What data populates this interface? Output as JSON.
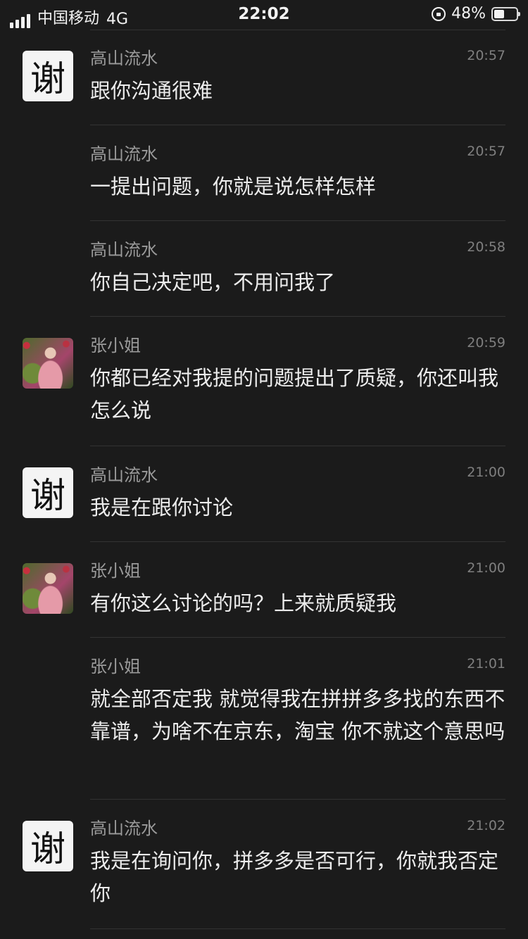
{
  "status_bar": {
    "carrier": "中国移动",
    "network": "4G",
    "time": "22:02",
    "battery_percent": "48%",
    "battery_level": 0.48,
    "icons": [
      "signal-icon",
      "rotation-lock-icon",
      "battery-icon"
    ]
  },
  "messages": [
    {
      "sender": "高山流水",
      "time": "20:57",
      "text": "跟你沟通很难",
      "avatar": "谢"
    },
    {
      "sender": "高山流水",
      "time": "20:57",
      "text": "一提出问题，你就是说怎样怎样",
      "avatar": ""
    },
    {
      "sender": "高山流水",
      "time": "20:58",
      "text": "你自己决定吧，不用问我了",
      "avatar": ""
    },
    {
      "sender": "张小姐",
      "time": "20:59",
      "text": "你都已经对我提的问题提出了质疑，你还叫我怎么说",
      "avatar": "photo"
    },
    {
      "sender": "高山流水",
      "time": "21:00",
      "text": "我是在跟你讨论",
      "avatar": "谢"
    },
    {
      "sender": "张小姐",
      "time": "21:00",
      "text": "有你这么讨论的吗？上来就质疑我",
      "avatar": "photo"
    },
    {
      "sender": "张小姐",
      "time": "21:01",
      "text": "就全部否定我 就觉得我在拼拼多多找的东西不靠谱，为啥不在京东，淘宝 你不就这个意思吗",
      "avatar": ""
    },
    {
      "sender": "高山流水",
      "time": "21:02",
      "text": "我是在询问你，拼多多是否可行，你就我否定你",
      "avatar": "谢"
    }
  ]
}
